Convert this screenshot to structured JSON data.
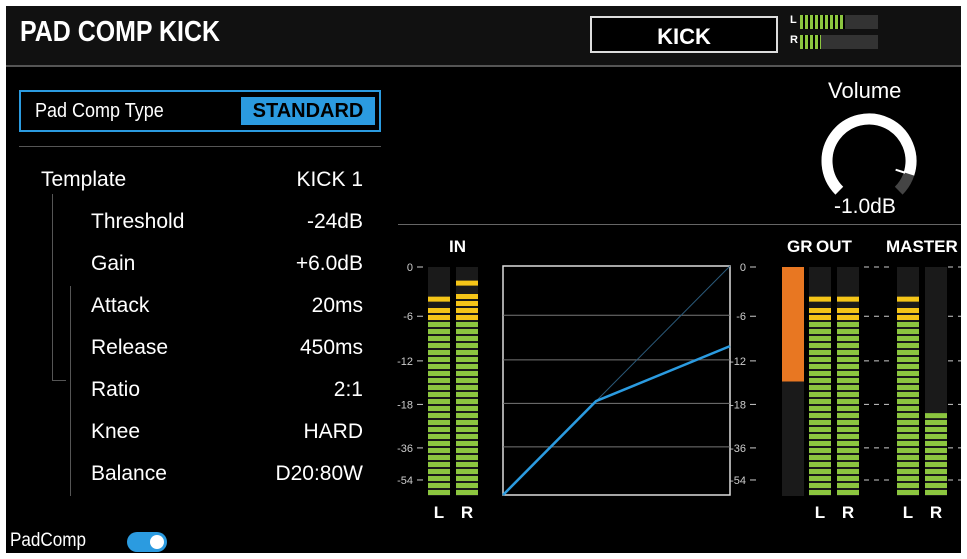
{
  "header": {
    "title": "PAD COMP KICK",
    "kit_name": "KICK",
    "mini_meter": {
      "left_label": "L",
      "right_label": "R",
      "left_level": 0.58,
      "right_level": 0.27
    }
  },
  "comp_type": {
    "label": "Pad Comp Type",
    "value": "STANDARD"
  },
  "params": [
    {
      "name": "Template",
      "value": "KICK 1"
    },
    {
      "name": "Threshold",
      "value": "-24dB"
    },
    {
      "name": "Gain",
      "value": "+6.0dB"
    },
    {
      "name": "Attack",
      "value": "20ms"
    },
    {
      "name": "Release",
      "value": "450ms"
    },
    {
      "name": "Ratio",
      "value": "2:1"
    },
    {
      "name": "Knee",
      "value": "HARD"
    },
    {
      "name": "Balance",
      "value": "D20:80W"
    }
  ],
  "volume": {
    "label": "Volume",
    "value": "-1.0dB",
    "level": 0.9
  },
  "meters": {
    "in_label": "IN",
    "gr_label": "GR",
    "out_label": "OUT",
    "master_label": "MASTER",
    "scale": [
      "0",
      "-6",
      "-12",
      "-18",
      "-36",
      "-54"
    ],
    "lr": [
      "L",
      "R"
    ],
    "in_levels": [
      0.84,
      0.91
    ],
    "in_peaks": [
      0.84,
      0.91
    ],
    "out_levels": [
      0.84,
      0.84
    ],
    "out_peaks": [
      0.84,
      0.84
    ],
    "gr_level": 0.5,
    "master_levels": [
      0.84,
      0.34
    ],
    "master_peaks": [
      0.84,
      0.34
    ]
  },
  "colors": {
    "accent": "#2b9be0",
    "meter_green": "#8cc63f",
    "meter_yellow": "#f5c518",
    "gr_orange": "#e87722"
  },
  "footer": {
    "padcomp_label": "PadComp",
    "padcomp_on": true
  }
}
